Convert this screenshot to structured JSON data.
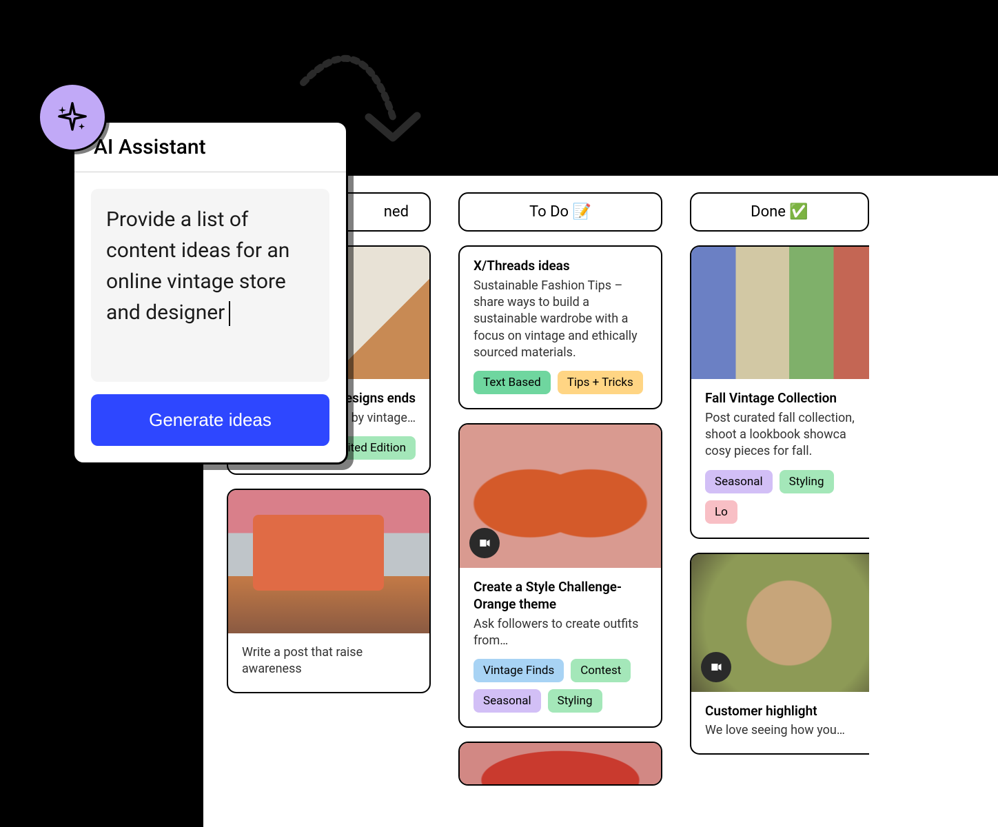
{
  "ai": {
    "title": "AI Assistant",
    "prompt": "Provide a list of content ideas for an online vintage store and designer",
    "button": "Generate ideas"
  },
  "columns": [
    {
      "title_prefix": "",
      "title_visible": "ned",
      "cards": [
        {
          "image": "img-bag-white",
          "title_frag": "nable Designs ends",
          "desc_frag": "sustainably d by vintage…",
          "tags": [
            {
              "label": "…",
              "cls": "blue",
              "hidden": true
            },
            {
              "label": "Limited Edition",
              "cls": "green"
            }
          ]
        },
        {
          "image": "img-bag-orange",
          "desc_frag": "Write a post that raise awareness"
        }
      ]
    },
    {
      "title": "To Do 📝",
      "cards": [
        {
          "title": "X/Threads ideas",
          "desc": "Sustainable Fashion Tips – share ways to build a sustainable wardrobe with a focus on vintage and ethically sourced materials.",
          "tags": [
            {
              "label": "Text Based",
              "cls": "green-dark"
            },
            {
              "label": "Tips + Tricks",
              "cls": "orange"
            }
          ]
        },
        {
          "image": "img-loafers",
          "video": true,
          "title": "Create a Style Challenge-Orange theme",
          "desc": "Ask followers to create outfits from…",
          "tags": [
            {
              "label": "Vintage Finds",
              "cls": "blue"
            },
            {
              "label": "Contest",
              "cls": "green"
            },
            {
              "label": "Seasonal",
              "cls": "purple"
            },
            {
              "label": "Styling",
              "cls": "green"
            }
          ]
        },
        {
          "image": "img-red"
        }
      ]
    },
    {
      "title": "Done ✅",
      "cards": [
        {
          "image": "img-sweater",
          "title": "Fall Vintage Collection",
          "desc": "Post curated fall collection, shoot a lookbook showca cosy pieces for fall.",
          "tags": [
            {
              "label": "Seasonal",
              "cls": "purple"
            },
            {
              "label": "Styling",
              "cls": "green"
            },
            {
              "label": "Lo",
              "cls": "pink"
            }
          ]
        },
        {
          "image": "img-scarf",
          "video": true,
          "title": "Customer highlight",
          "desc": "We love seeing how you…"
        }
      ]
    }
  ]
}
